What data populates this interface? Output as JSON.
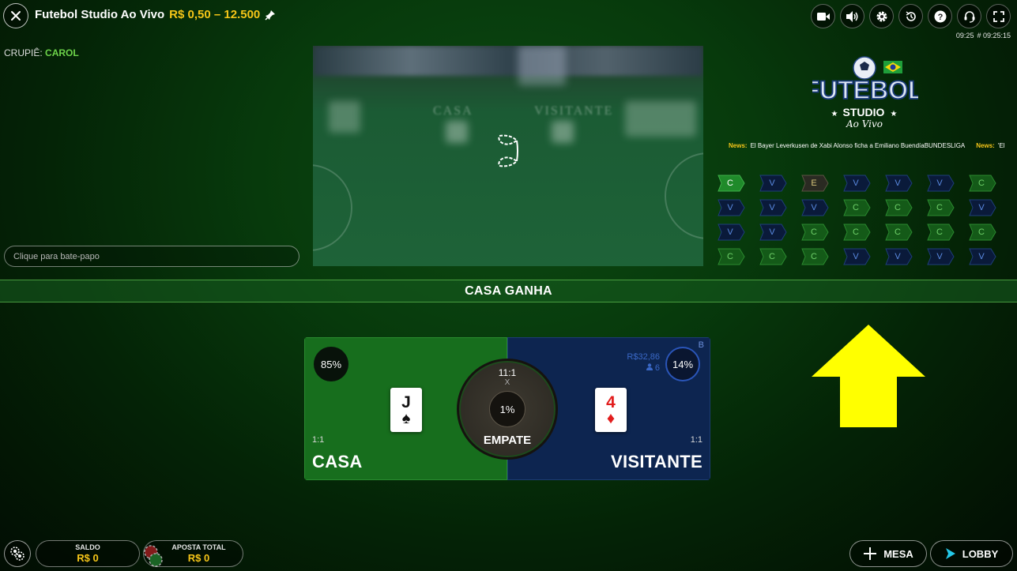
{
  "header": {
    "title": "Futebol Studio Ao Vivo",
    "limits": "R$ 0,50 – 12.500",
    "time": "09:25",
    "round_id": "# 09:25:15",
    "icons": [
      "video-icon",
      "volume-icon",
      "settings-icon",
      "history-icon",
      "help-icon",
      "support-icon",
      "fullscreen-icon"
    ]
  },
  "dealer": {
    "label": "CRUPIÊ:",
    "name": "CAROL"
  },
  "video": {
    "left_text": "CASA",
    "right_text": "VISITANTE"
  },
  "chat": {
    "placeholder": "Clique para bate-papo"
  },
  "logo": {
    "line1": "FUTEBOL",
    "line2": "STUDIO",
    "line3": "Ao Vivo"
  },
  "news": [
    {
      "label": "News:",
      "text": "El Bayer Leverkusen de Xabi Alonso ficha a Emiliano BuendíaBUNDESLIGA"
    },
    {
      "label": "News:",
      "text": "'El"
    }
  ],
  "roadmap": [
    [
      "C",
      "V",
      "E",
      "V",
      "V",
      "V",
      "C"
    ],
    [
      "V",
      "V",
      "V",
      "C",
      "C",
      "C",
      "V"
    ],
    [
      "V",
      "V",
      "C",
      "C",
      "C",
      "C",
      "C"
    ],
    [
      "C",
      "C",
      "C",
      "V",
      "V",
      "V",
      "V"
    ]
  ],
  "result": {
    "text": "CASA GANHA"
  },
  "board": {
    "casa": {
      "percent": "85%",
      "payout": "1:1",
      "label": "CASA",
      "card_rank": "J",
      "card_suit": "♠"
    },
    "visitante": {
      "percent": "14%",
      "payout": "1:1",
      "label": "VISITANTE",
      "card_rank": "4",
      "card_suit": "♦",
      "amount": "R$32,86",
      "players": "6",
      "corner": "B"
    },
    "empate": {
      "payout": "11:1",
      "symbol": "X",
      "percent": "1%",
      "label": "EMPATE"
    }
  },
  "bottom": {
    "saldo_label": "SALDO",
    "saldo_value": "R$ 0",
    "aposta_label": "APOSTA TOTAL",
    "aposta_value": "R$ 0",
    "mesa_label": "MESA",
    "lobby_label": "LOBBY"
  },
  "colors": {
    "accent_gold": "#f5c518",
    "casa_green": "#176e1d",
    "visitante_blue": "#0d2550",
    "arrow_yellow": "#ffff00"
  }
}
